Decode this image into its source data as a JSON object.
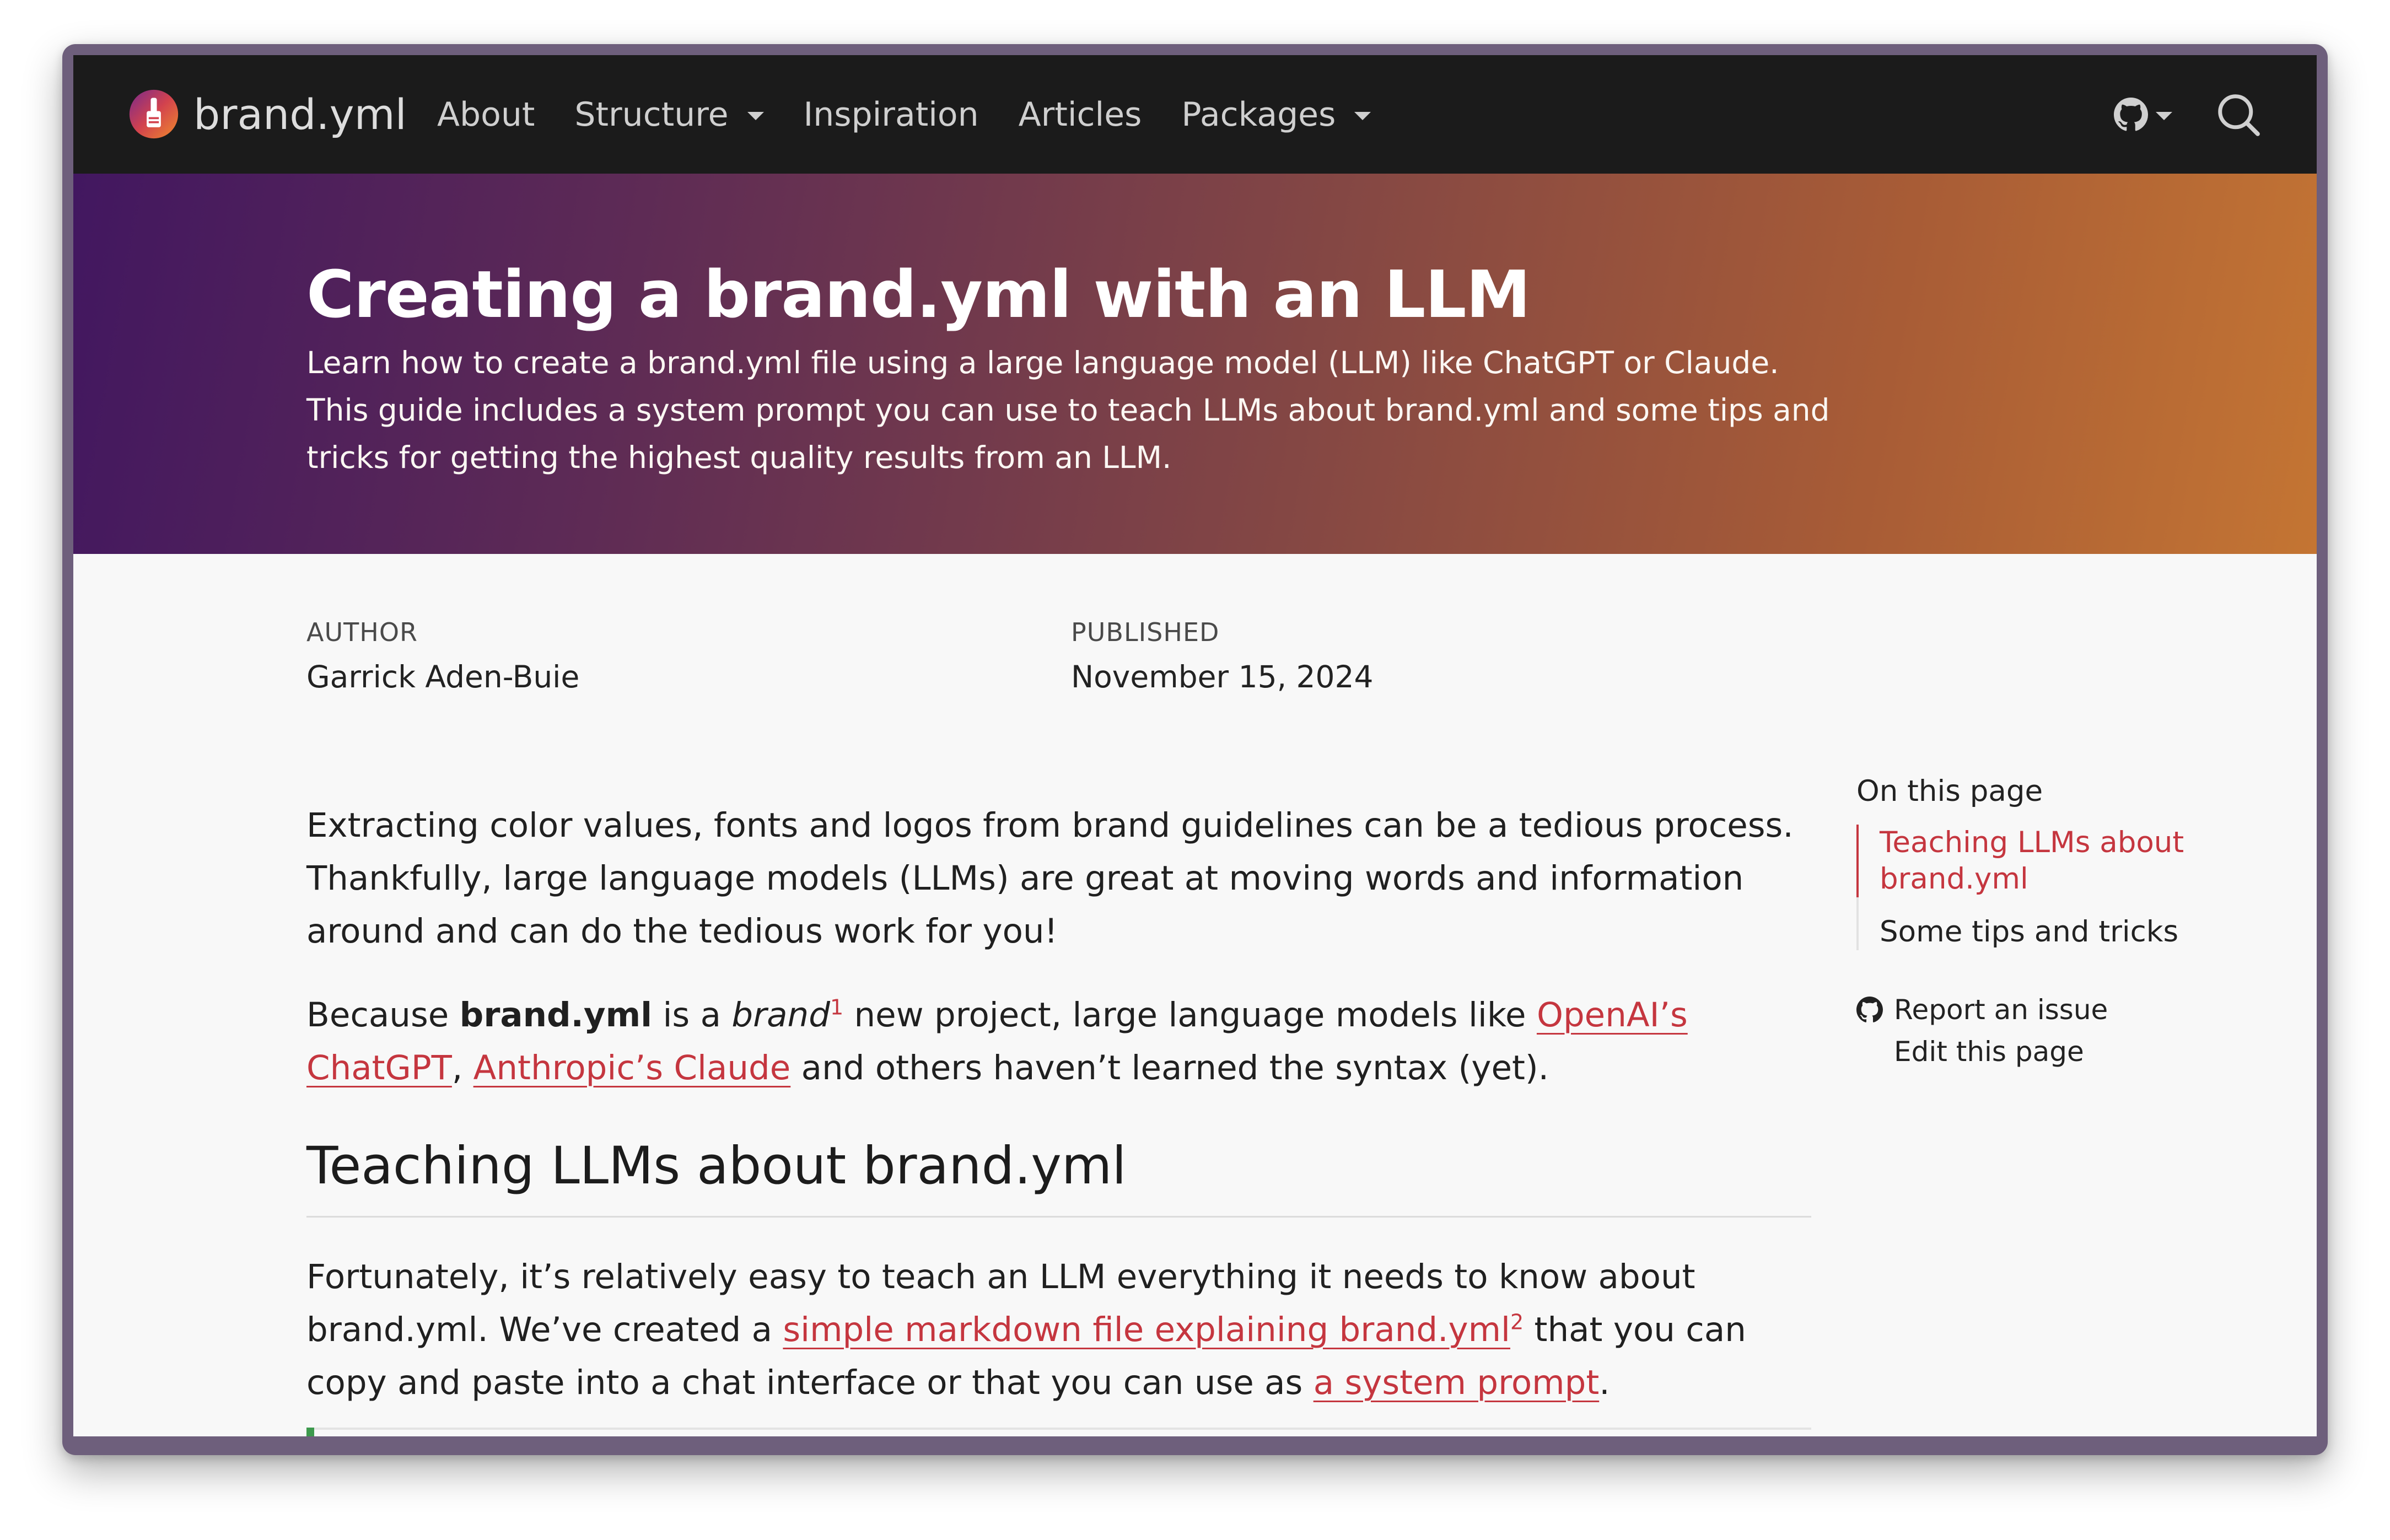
{
  "navbar": {
    "brand": "brand.yml",
    "items": [
      {
        "label": "About",
        "dropdown": false
      },
      {
        "label": "Structure",
        "dropdown": true
      },
      {
        "label": "Inspiration",
        "dropdown": false
      },
      {
        "label": "Articles",
        "dropdown": false
      },
      {
        "label": "Packages",
        "dropdown": true
      }
    ],
    "icons": [
      "github-icon",
      "search-icon"
    ]
  },
  "hero": {
    "title": "Creating a brand.yml with an LLM",
    "subtitle": "Learn how to create a brand.yml file using a large language model (LLM) like ChatGPT or Claude. This guide includes a system prompt you can use to teach LLMs about brand.yml and some tips and tricks for getting the highest quality results from an LLM."
  },
  "meta": {
    "author_label": "AUTHOR",
    "author": "Garrick Aden-Buie",
    "published_label": "PUBLISHED",
    "published": "November 15, 2024"
  },
  "body": {
    "p1": "Extracting color values, fonts and logos from brand guidelines can be a tedious process. Thankfully, large language models (LLMs) are great at moving words and information around and can do the tedious work for you!",
    "p2_a": "Because ",
    "p2_bold": "brand.yml",
    "p2_b": " is a ",
    "p2_italic": "brand",
    "p2_sup": "1",
    "p2_c": " new project, large language models like ",
    "p2_link1": "OpenAI’s ChatGPT",
    "p2_d": ", ",
    "p2_link2": "Anthropic’s Claude",
    "p2_e": " and others haven’t learned the syntax (yet).",
    "h2": "Teaching LLMs about brand.yml",
    "p3_a": "Fortunately, it’s relatively easy to teach an LLM everything it needs to know about brand.yml. We’ve created a ",
    "p3_link1": "simple markdown file explaining brand.yml",
    "p3_sup": "2",
    "p3_b": " that you can copy and paste into a chat interface or that you can use as ",
    "p3_link2": "a system prompt",
    "p3_c": "."
  },
  "toc": {
    "title": "On this page",
    "items": [
      {
        "label": "Teaching LLMs about brand.yml",
        "active": true
      },
      {
        "label": "Some tips and tricks",
        "active": false
      }
    ],
    "report_issue": "Report an issue",
    "edit_page": "Edit this page"
  },
  "colors": {
    "navbar_bg": "#1b1b1b",
    "hero_gradient_start": "#421760",
    "hero_gradient_end": "#c47533",
    "link": "#c5363f",
    "page_bg": "#f8f8f8"
  }
}
